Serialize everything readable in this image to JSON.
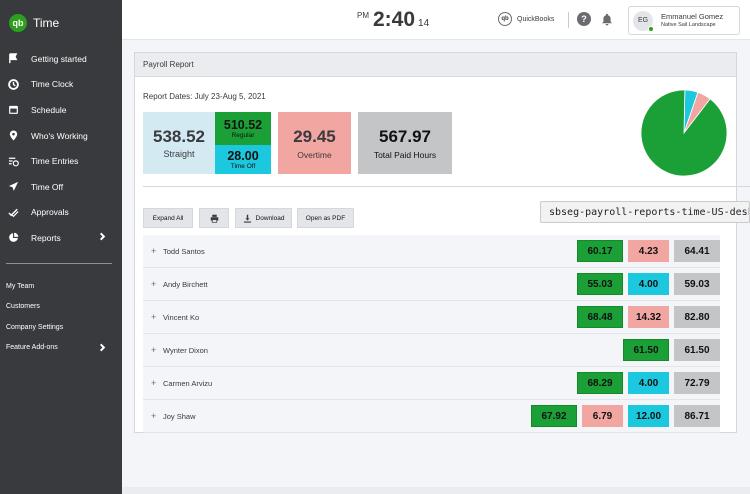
{
  "app": {
    "logo_text": "qb",
    "name": "Time"
  },
  "sidebar": {
    "items": [
      {
        "label": "Getting started",
        "icon": "flag-icon"
      },
      {
        "label": "Time Clock",
        "icon": "clock-icon"
      },
      {
        "label": "Schedule",
        "icon": "calendar-icon"
      },
      {
        "label": "Who's Working",
        "icon": "map-pin-icon"
      },
      {
        "label": "Time Entries",
        "icon": "list-clock-icon"
      },
      {
        "label": "Time Off",
        "icon": "airplane-icon"
      },
      {
        "label": "Approvals",
        "icon": "checkmark-icon"
      },
      {
        "label": "Reports",
        "icon": "pie-chart-icon"
      }
    ],
    "secondary": [
      {
        "label": "My Team"
      },
      {
        "label": "Customers"
      },
      {
        "label": "Company Settings"
      },
      {
        "label": "Feature Add-ons"
      }
    ]
  },
  "header": {
    "clock_ampm": "PM",
    "clock_time": "2:40",
    "clock_seconds": "14",
    "quickbooks_label": "QuickBooks",
    "quickbooks_logo": "qb",
    "help_label": "?",
    "user_initials": "EG",
    "user_name": "Emmanuel Gomez",
    "user_company": "Native Sail Landscape"
  },
  "report": {
    "title": "Payroll Report",
    "dates": "Report Dates: July 23-Aug 5, 2021",
    "straight_value": "538.52",
    "straight_label": "Straight",
    "regular_value": "510.52",
    "regular_label": "Regular",
    "timeoff_value": "28.00",
    "timeoff_label": "Time Off",
    "overtime_value": "29.45",
    "overtime_label": "Overtime",
    "total_value": "567.97",
    "total_label": "Total Paid Hours",
    "buttons": {
      "expand_all": "Expand All",
      "download": "Download",
      "open_pdf": "Open as PDF"
    },
    "tooltip": "sbseg-payroll-reports-time-US-desktop",
    "colors": {
      "regular": "#1aa036",
      "time_off": "#1bc8dd",
      "overtime": "#f2a6a2",
      "total": "#c4c5c7"
    }
  },
  "chart_data": {
    "type": "pie",
    "categories": [
      "Regular",
      "Time Off",
      "Overtime"
    ],
    "values": [
      510.52,
      28.0,
      29.45
    ],
    "colors": [
      "#1aa036",
      "#1bc8dd",
      "#f2a6a2"
    ]
  },
  "employees": [
    {
      "name": "Todd Santos",
      "cells": [
        {
          "type": "green",
          "value": "60.17"
        },
        {
          "type": "red",
          "value": "4.23"
        },
        {
          "type": "gray",
          "value": "64.41"
        }
      ]
    },
    {
      "name": "Andy Birchett",
      "cells": [
        {
          "type": "green",
          "value": "55.03"
        },
        {
          "type": "blue",
          "value": "4.00"
        },
        {
          "type": "gray",
          "value": "59.03"
        }
      ]
    },
    {
      "name": "Vincent Ko",
      "cells": [
        {
          "type": "green",
          "value": "68.48"
        },
        {
          "type": "red",
          "value": "14.32"
        },
        {
          "type": "gray",
          "value": "82.80"
        }
      ]
    },
    {
      "name": "Wynter Dixon",
      "cells": [
        {
          "type": "green",
          "value": "61.50"
        },
        {
          "type": "gray",
          "value": "61.50"
        }
      ]
    },
    {
      "name": "Carmen Arvizu",
      "cells": [
        {
          "type": "green",
          "value": "68.29"
        },
        {
          "type": "blue",
          "value": "4.00"
        },
        {
          "type": "gray",
          "value": "72.79"
        }
      ]
    },
    {
      "name": "Joy Shaw",
      "cells": [
        {
          "type": "green",
          "value": "67.92"
        },
        {
          "type": "red",
          "value": "6.79"
        },
        {
          "type": "blue",
          "value": "12.00"
        },
        {
          "type": "gray",
          "value": "86.71"
        }
      ]
    }
  ]
}
